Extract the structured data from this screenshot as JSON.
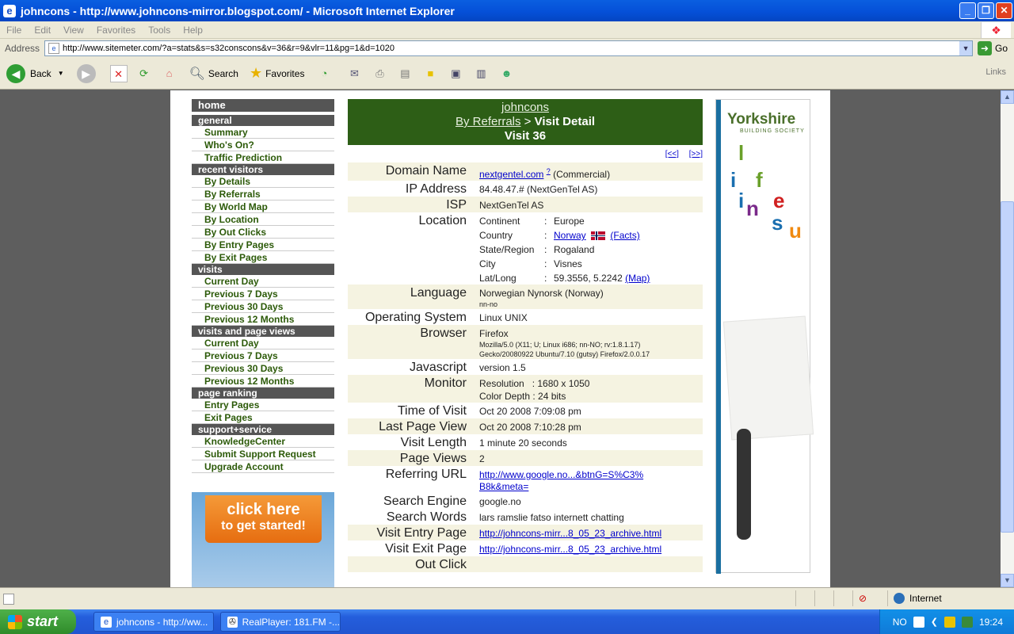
{
  "window": {
    "title": "johncons - http://www.johncons-mirror.blogspot.com/ - Microsoft Internet Explorer"
  },
  "menu": [
    "File",
    "Edit",
    "View",
    "Favorites",
    "Tools",
    "Help"
  ],
  "address": {
    "label": "Address",
    "url": "http://www.sitemeter.com/?a=stats&s=s32conscons&v=36&r=9&vlr=11&pg=1&d=1020",
    "go": "Go"
  },
  "toolbar": {
    "back": "Back",
    "search": "Search",
    "favorites": "Favorites",
    "links": "Links"
  },
  "nav": {
    "home": "home",
    "sections": [
      {
        "title": "general",
        "items": [
          "Summary",
          "Who's On?",
          "Traffic Prediction"
        ]
      },
      {
        "title": "recent visitors",
        "items": [
          "By Details",
          "By Referrals",
          "By World Map",
          "By Location",
          "By Out Clicks",
          "By Entry Pages",
          "By Exit Pages"
        ]
      },
      {
        "title": "visits",
        "items": [
          "Current Day",
          "Previous 7 Days",
          "Previous 30 Days",
          "Previous 12 Months"
        ]
      },
      {
        "title": "visits and page views",
        "items": [
          "Current Day",
          "Previous 7 Days",
          "Previous 30 Days",
          "Previous 12 Months"
        ]
      },
      {
        "title": "page ranking",
        "items": [
          "Entry Pages",
          "Exit Pages"
        ]
      },
      {
        "title": "support+service",
        "items": [
          "KnowledgeCenter",
          "Submit Support Request",
          "Upgrade Account"
        ]
      }
    ]
  },
  "banner": {
    "line1": "click here",
    "line2": "to get started!"
  },
  "header": {
    "site": "johncons",
    "crumb_link": "By Referrals",
    "crumb_sep": " > ",
    "crumb_current": "Visit Detail",
    "visit": "Visit 36"
  },
  "pager": {
    "prev": "[<<]",
    "next": "[>>]"
  },
  "detail": {
    "domain_label": "Domain Name",
    "domain_link": "nextgentel.com",
    "domain_sup": "?",
    "domain_type": "(Commercial)",
    "ip_label": "IP Address",
    "ip": "84.48.47.# (NextGenTel AS)",
    "isp_label": "ISP",
    "isp": "NextGenTel AS",
    "location_label": "Location",
    "location": {
      "continent_k": "Continent",
      "continent": "Europe",
      "country_k": "Country",
      "country": "Norway",
      "facts": "(Facts)",
      "state_k": "State/Region",
      "state": "Rogaland",
      "city_k": "City",
      "city": "Visnes",
      "latlong_k": "Lat/Long",
      "latlong": "59.3556, 5.2242",
      "map": "(Map)",
      "colon": ":"
    },
    "language_label": "Language",
    "language": "Norwegian Nynorsk (Norway)",
    "language_code": "nn-no",
    "os_label": "Operating System",
    "os": "Linux UNIX",
    "browser_label": "Browser",
    "browser": "Firefox",
    "ua1": "Mozilla/5.0 (X11; U; Linux i686; nn-NO; rv:1.8.1.17)",
    "ua2": "Gecko/20080922 Ubuntu/7.10 (gutsy) Firefox/2.0.0.17",
    "js_label": "Javascript",
    "js": "version 1.5",
    "monitor_label": "Monitor",
    "resolution": "Resolution   : 1680 x 1050",
    "color_depth": "Color Depth : 24 bits",
    "tov_label": "Time of Visit",
    "tov": "Oct 20 2008 7:09:08 pm",
    "lpv_label": "Last Page View",
    "lpv": "Oct 20 2008 7:10:28 pm",
    "vl_label": "Visit Length",
    "vl": "1 minute 20 seconds",
    "pv_label": "Page Views",
    "pv": "2",
    "ref_label": "Referring URL",
    "ref1": "http://www.google.no...&btnG=S%C3%",
    "ref2": "B8k&meta=",
    "se_label": "Search Engine",
    "se": "google.no",
    "sw_label": "Search Words",
    "sw": "lars ramslie fatso internett chatting",
    "entry_label": "Visit Entry Page",
    "entry": "http://johncons-mirr...8_05_23_archive.html",
    "exit_label": "Visit Exit Page",
    "exit": "http://johncons-mirr...8_05_23_archive.html",
    "out_label": "Out Click",
    "out": ""
  },
  "ad": {
    "brand": "Yorkshire",
    "sub": "BUILDING SOCIETY",
    "letters": [
      "l",
      "i",
      "f",
      "e",
      "i",
      "n",
      "s",
      "u"
    ]
  },
  "status": {
    "zone": "Internet"
  },
  "taskbar": {
    "start": "start",
    "tasks": [
      "johncons - http://ww...",
      "RealPlayer: 181.FM -..."
    ],
    "lang": "NO",
    "time": "19:24"
  }
}
